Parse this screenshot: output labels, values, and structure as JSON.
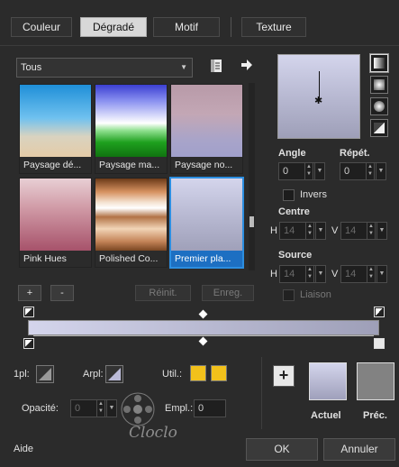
{
  "tabs": [
    {
      "label": "Couleur",
      "active": false
    },
    {
      "label": "Dégradé",
      "active": true
    },
    {
      "label": "Motif",
      "active": false
    },
    {
      "label": "Texture",
      "active": false
    }
  ],
  "category": {
    "value": "Tous"
  },
  "gradients": [
    {
      "name": "Paysage dé...",
      "selected": false
    },
    {
      "name": "Paysage ma...",
      "selected": false
    },
    {
      "name": "Paysage no...",
      "selected": false
    },
    {
      "name": "Pink Hues",
      "selected": false
    },
    {
      "name": "Polished Co...",
      "selected": false
    },
    {
      "name": "Premier pla...",
      "selected": true
    }
  ],
  "list_buttons": {
    "add": "+",
    "remove": "-",
    "reset": "Réinit.",
    "save": "Enreg."
  },
  "settings": {
    "angle_label": "Angle",
    "angle_value": "0",
    "repeat_label": "Répét.",
    "repeat_value": "0",
    "invert_label": "Invers",
    "center_label": "Centre",
    "center_h_label": "H",
    "center_h_value": "14",
    "center_v_label": "V",
    "center_v_value": "14",
    "source_label": "Source",
    "source_h_label": "H",
    "source_h_value": "14",
    "source_v_label": "V",
    "source_v_value": "14",
    "link_label": "Liaison"
  },
  "stops": {
    "foreground_label": "1pl:",
    "background_label": "Arpl:",
    "user_label": "Util.:",
    "opacity_label": "Opacité:",
    "opacity_value": "0",
    "location_label": "Empl.:",
    "location_value": "0"
  },
  "preview": {
    "add_button": "+",
    "current_label": "Actuel",
    "previous_label": "Préc."
  },
  "watermark_text": "Cloclo",
  "footer": {
    "help": "Aide",
    "ok": "OK",
    "cancel": "Annuler"
  },
  "colors": {
    "accent": "#2c8ee0",
    "user_color": "#f2c11b",
    "current_color_top": "#d4d5ec",
    "current_color_bottom": "#9fa0bb",
    "previous_color": "#828282"
  }
}
